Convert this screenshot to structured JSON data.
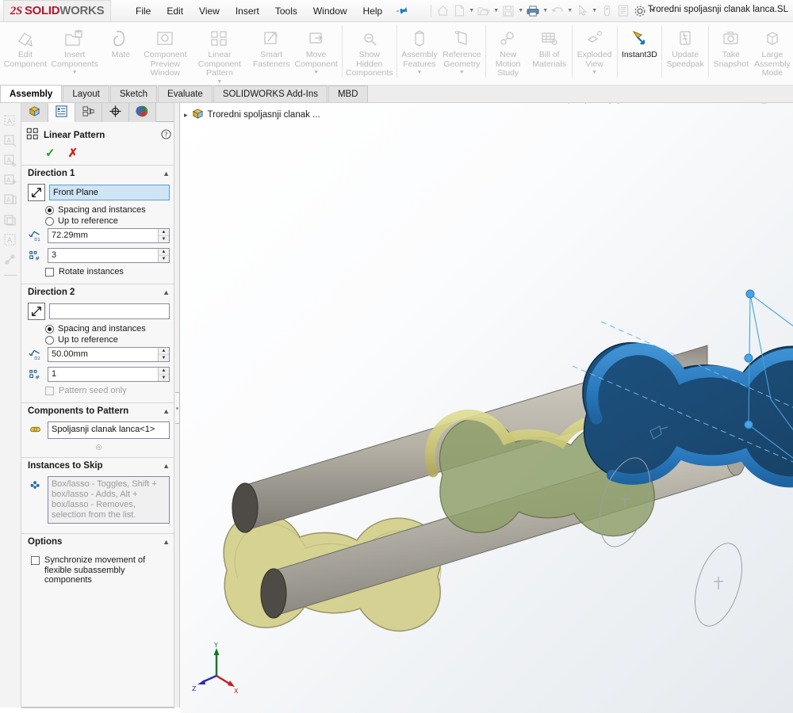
{
  "window": {
    "logo_ds": "2S",
    "logo_solid": "SOLID",
    "logo_works": "WORKS",
    "document_title": "Troredni spoljasnji clanak lanca.SL"
  },
  "menu": {
    "items": [
      "File",
      "Edit",
      "View",
      "Insert",
      "Tools",
      "Window",
      "Help"
    ],
    "pin_icon": "pushpin-icon"
  },
  "quick_access": {
    "buttons": [
      {
        "name": "home-icon",
        "label": "Home"
      },
      {
        "name": "new-document-icon",
        "label": "New"
      },
      {
        "name": "open-folder-icon",
        "label": "Open"
      },
      {
        "name": "save-icon",
        "label": "Save"
      },
      {
        "name": "print-icon",
        "label": "Print"
      },
      {
        "name": "undo-icon",
        "label": "Undo"
      },
      {
        "name": "select-cursor-icon",
        "label": "Select"
      },
      {
        "name": "rebuild-icon",
        "label": "Rebuild"
      },
      {
        "name": "file-properties-icon",
        "label": "File Properties"
      },
      {
        "name": "options-gear-icon",
        "label": "Options"
      }
    ]
  },
  "ribbon": {
    "commands": [
      {
        "label": "Edit\nComponent",
        "icon": "edit-component-icon",
        "dropdown": false,
        "enabled": false
      },
      {
        "label": "Insert\nComponents",
        "icon": "insert-components-icon",
        "dropdown": true,
        "enabled": false
      },
      {
        "label": "Mate",
        "icon": "mate-icon",
        "dropdown": false,
        "enabled": false
      },
      {
        "label": "Component\nPreview\nWindow",
        "icon": "component-preview-window-icon",
        "dropdown": false,
        "enabled": false
      },
      {
        "label": "Linear Component\nPattern",
        "icon": "linear-component-pattern-icon",
        "dropdown": true,
        "enabled": false
      },
      {
        "label": "Smart\nFasteners",
        "icon": "smart-fasteners-icon",
        "dropdown": false,
        "enabled": false
      },
      {
        "label": "Move\nComponent",
        "icon": "move-component-icon",
        "dropdown": true,
        "enabled": false
      },
      {
        "label": "Show\nHidden\nComponents",
        "icon": "show-hidden-components-icon",
        "dropdown": false,
        "enabled": false
      },
      {
        "label": "Assembly\nFeatures",
        "icon": "assembly-features-icon",
        "dropdown": true,
        "enabled": false
      },
      {
        "label": "Reference\nGeometry",
        "icon": "reference-geometry-icon",
        "dropdown": true,
        "enabled": false
      },
      {
        "label": "New\nMotion\nStudy",
        "icon": "new-motion-study-icon",
        "dropdown": false,
        "enabled": false
      },
      {
        "label": "Bill of\nMaterials",
        "icon": "bill-of-materials-icon",
        "dropdown": false,
        "enabled": false
      },
      {
        "label": "Exploded\nView",
        "icon": "exploded-view-icon",
        "dropdown": true,
        "enabled": false
      },
      {
        "label": "Instant3D",
        "icon": "instant3d-icon",
        "dropdown": false,
        "enabled": true
      },
      {
        "label": "Update\nSpeedpak",
        "icon": "update-speedpak-icon",
        "dropdown": false,
        "enabled": false
      },
      {
        "label": "Take\nSnapshot",
        "icon": "take-snapshot-icon",
        "dropdown": false,
        "enabled": false
      },
      {
        "label": "Large\nAssembly\nMode",
        "icon": "large-assembly-mode-icon",
        "dropdown": false,
        "enabled": false
      }
    ]
  },
  "command_tabs": {
    "tabs": [
      "Assembly",
      "Layout",
      "Sketch",
      "Evaluate",
      "SOLIDWORKS Add-Ins",
      "MBD"
    ],
    "active": "Assembly"
  },
  "left_toolbar": {
    "icons": [
      "note-icon",
      "balloon-icon",
      "surface-finish-icon",
      "weld-symbol-icon",
      "datum-feature-icon",
      "block-icon",
      "area-hatch-icon",
      "dimension-icon"
    ]
  },
  "property_manager": {
    "tabs": [
      {
        "name": "feature-manager-tree-tab",
        "icon": "assembly-tree-icon",
        "active": false
      },
      {
        "name": "property-manager-tab",
        "icon": "property-list-icon",
        "active": true
      },
      {
        "name": "configuration-manager-tab",
        "icon": "configuration-icon",
        "active": false
      },
      {
        "name": "dimxpert-manager-tab",
        "icon": "dimxpert-target-icon",
        "active": false
      },
      {
        "name": "display-manager-tab",
        "icon": "appearance-sphere-icon",
        "active": false
      }
    ],
    "title": "Linear Pattern",
    "title_icon": "linear-pattern-icon",
    "help_icon": "help-question-icon",
    "ok_label": "✓",
    "cancel_label": "✗",
    "direction1": {
      "group_title": "Direction 1",
      "reference_value": "Front Plane",
      "reference_icon": "pattern-direction-arrow-icon",
      "mode_options": [
        "Spacing and instances",
        "Up to reference"
      ],
      "mode_selected": "Spacing and instances",
      "spacing_icon": "spacing-d1-icon",
      "spacing_value": "72.29mm",
      "instances_icon": "instance-count-icon",
      "instances_value": "3",
      "rotate_label": "Rotate instances",
      "rotate_checked": false
    },
    "direction2": {
      "group_title": "Direction 2",
      "reference_value": "",
      "reference_icon": "pattern-direction-arrow-icon",
      "mode_options": [
        "Spacing and instances",
        "Up to reference"
      ],
      "mode_selected": "Spacing and instances",
      "spacing_icon": "spacing-d2-icon",
      "spacing_value": "50.00mm",
      "instances_icon": "instance-count-icon",
      "instances_value": "1",
      "seed_only_label": "Pattern seed only",
      "seed_only_checked": false,
      "seed_only_enabled": false
    },
    "components_to_pattern": {
      "group_title": "Components to Pattern",
      "icon": "component-selection-icon",
      "value": "Spoljasnji clanak lanca<1>"
    },
    "instances_to_skip": {
      "group_title": "Instances to Skip",
      "icon": "instances-to-skip-icon",
      "hint": "Box/lasso - Toggles, Shift + box/lasso - Adds, Alt + box/lasso - Removes, selection from the list."
    },
    "options": {
      "group_title": "Options",
      "sync_label": "Synchronize movement of flexible subassembly components",
      "sync_checked": false
    }
  },
  "graphics": {
    "feature_tree_root": "Troredni spoljasnji clanak ...",
    "feature_tree_icon": "assembly-document-icon",
    "expand_arrow": "▸",
    "view_toolbar": [
      {
        "name": "zoom-to-fit-icon",
        "dropdown": false
      },
      {
        "name": "zoom-to-area-icon",
        "dropdown": false
      },
      {
        "name": "previous-view-icon",
        "dropdown": false
      },
      {
        "name": "section-view-icon",
        "dropdown": false
      },
      {
        "name": "view-orientation-icon",
        "dropdown": false
      },
      {
        "name": "display-style-icon",
        "dropdown": true
      },
      {
        "name": "hide-show-items-icon",
        "dropdown": true
      },
      {
        "name": "edit-appearance-icon",
        "dropdown": true
      },
      {
        "name": "apply-scene-icon",
        "dropdown": true
      },
      {
        "name": "view-settings-icon",
        "dropdown": true
      }
    ],
    "triad": {
      "x_label": "X",
      "y_label": "Y",
      "z_label": "Z"
    },
    "model": {
      "name": "roller-chain-link-assembly",
      "selected_component_color": "#1d4c73",
      "selected_rim_color": "#2f7fc1",
      "plate_color": "#cdc878",
      "plate_shadow_color": "#8a9a62",
      "pin_color": "#b6b1a6",
      "pin_bore_color": "#4b4742",
      "preview_line_color": "#49a0e0"
    }
  }
}
